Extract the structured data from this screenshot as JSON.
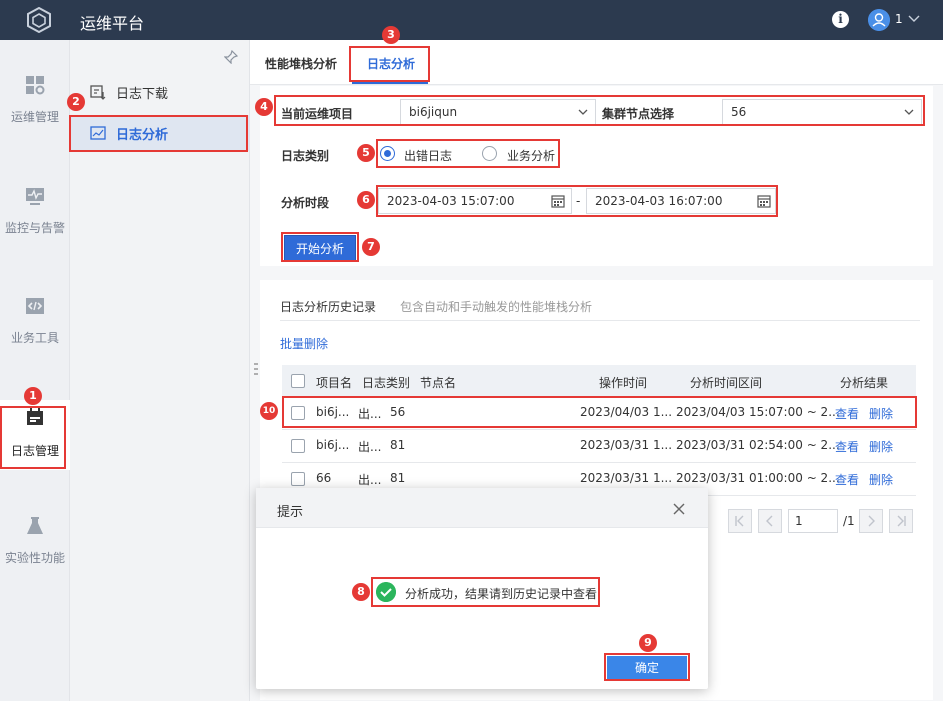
{
  "app": {
    "title": "运维平台",
    "user": "1"
  },
  "leftnav": {
    "items": [
      {
        "label": "运维管理"
      },
      {
        "label": "监控与告警"
      },
      {
        "label": "业务工具"
      },
      {
        "label": "日志管理"
      },
      {
        "label": "实验性功能"
      }
    ]
  },
  "subnav": {
    "items": [
      {
        "label": "日志下载"
      },
      {
        "label": "日志分析"
      }
    ]
  },
  "tabs": [
    {
      "label": "性能堆栈分析"
    },
    {
      "label": "日志分析"
    }
  ],
  "form": {
    "project_label": "当前运维项目",
    "project_value": "bi6jiqun",
    "node_label": "集群节点选择",
    "node_value": "56",
    "type_label": "日志类别",
    "type_options": [
      {
        "label": "出错日志",
        "checked": true
      },
      {
        "label": "业务分析",
        "checked": false
      }
    ],
    "period_label": "分析时段",
    "start_time": "2023-04-03 15:07:00",
    "range_sep": "-",
    "end_time": "2023-04-03 16:07:00",
    "start_button": "开始分析"
  },
  "history": {
    "title": "日志分析历史记录",
    "subtitle": "包含自动和手动触发的性能堆栈分析",
    "batch_delete": "批量删除",
    "columns": [
      "项目名",
      "日志类别",
      "节点名",
      "操作时间",
      "分析时间区间",
      "分析结果"
    ],
    "rows": [
      {
        "project": "bi6j...",
        "type": "出...",
        "node": "56",
        "op_time": "2023/04/03 1...",
        "range": "2023/04/03 15:07:00 ~ 2...",
        "view": "查看",
        "delete": "删除"
      },
      {
        "project": "bi6j...",
        "type": "出...",
        "node": "81",
        "op_time": "2023/03/31 1...",
        "range": "2023/03/31 02:54:00 ~ 2...",
        "view": "查看",
        "delete": "删除"
      },
      {
        "project": "66",
        "type": "出...",
        "node": "81",
        "op_time": "2023/03/31 1...",
        "range": "2023/03/31 01:00:00 ~ 2...",
        "view": "查看",
        "delete": "删除"
      }
    ],
    "page": "1",
    "page_total": "/1"
  },
  "dialog": {
    "title": "提示",
    "message": "分析成功，结果请到历史记录中查看",
    "ok": "确定"
  },
  "markers": [
    "1",
    "2",
    "3",
    "4",
    "5",
    "6",
    "7",
    "8",
    "9",
    "10"
  ],
  "colors": {
    "accent": "#2f6bd8",
    "header": "#2c3a4f",
    "annotation": "#e53935",
    "success": "#2bb55c"
  }
}
